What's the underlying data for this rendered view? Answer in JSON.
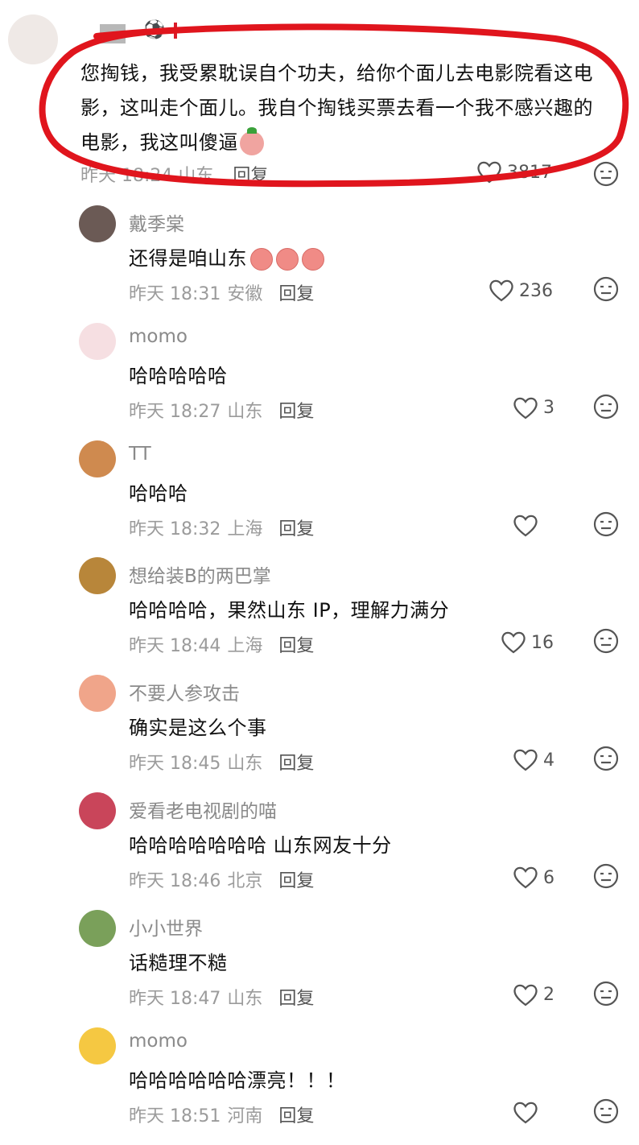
{
  "top_comment": {
    "text": "您掏钱，我受累耽误自个功夫，给你个面儿去电影院看这电影，这叫走个面儿。我自个掏钱买票去看一个我不感兴趣的电影，我这叫傻逼",
    "meta": "昨天 18:24 山东",
    "reply": "回复",
    "likes": "3817",
    "badge_icon": "soccer-ball-icon"
  },
  "comments": [
    {
      "name": "戴季棠",
      "text": "还得是咱山东",
      "emoji_count": 3,
      "time": "昨天 18:31",
      "location": "安徽",
      "reply": "回复",
      "likes": "236",
      "avatar_color": "#6b5a55"
    },
    {
      "name": "momo",
      "text": "哈哈哈哈哈",
      "time": "昨天 18:27",
      "location": "山东",
      "reply": "回复",
      "likes": "3",
      "avatar_color": "#f6dfe2"
    },
    {
      "name": "TT",
      "text": "哈哈哈",
      "time": "昨天 18:32",
      "location": "上海",
      "reply": "回复",
      "likes": "",
      "avatar_color": "#cf8a4f"
    },
    {
      "name": "想给装B的两巴掌",
      "text": "哈哈哈哈，果然山东 IP，理解力满分",
      "time": "昨天 18:44",
      "location": "上海",
      "reply": "回复",
      "likes": "16",
      "avatar_color": "#b8863a"
    },
    {
      "name": "不要人参攻击",
      "text": "确实是这么个事",
      "time": "昨天 18:45",
      "location": "山东",
      "reply": "回复",
      "likes": "4",
      "avatar_color": "#f0a58a"
    },
    {
      "name": "爱看老电视剧的喵",
      "text": "哈哈哈哈哈哈哈 山东网友十分",
      "time": "昨天 18:46",
      "location": "北京",
      "reply": "回复",
      "likes": "6",
      "avatar_color": "#c9455a"
    },
    {
      "name": "小小世界",
      "text": "话糙理不糙",
      "time": "昨天 18:47",
      "location": "山东",
      "reply": "回复",
      "likes": "2",
      "avatar_color": "#7aa05a"
    },
    {
      "name": "momo",
      "text": "哈哈哈哈哈哈漂亮！！！",
      "time": "昨天 18:51",
      "location": "河南",
      "reply": "回复",
      "likes": "",
      "avatar_color": "#f5c842"
    }
  ],
  "colors": {
    "annotation": "#e0151d",
    "meta_text": "#9b9b9b"
  }
}
